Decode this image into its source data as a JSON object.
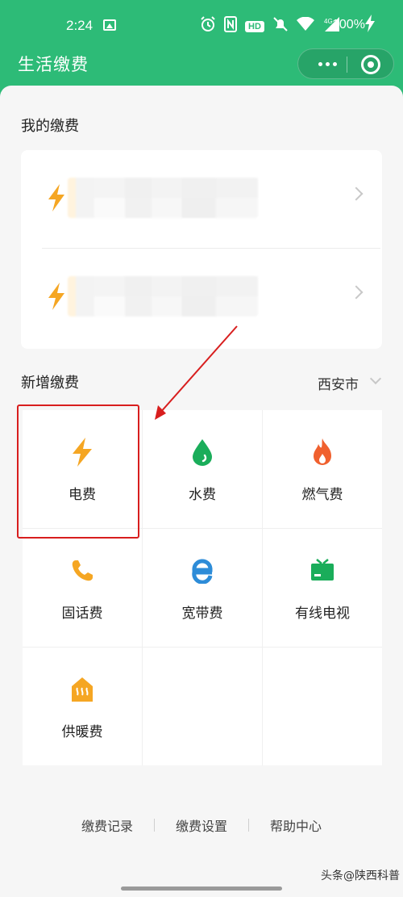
{
  "status_bar": {
    "time": "2:24",
    "icons": [
      "gallery-icon",
      "alarm-icon",
      "nfc-icon",
      "hd-icon",
      "mute-icon",
      "wifi-icon",
      "signal-icon"
    ],
    "hd_label": "HD",
    "network": "4G",
    "battery": "100%"
  },
  "navbar": {
    "title": "生活缴费",
    "more_icon": "more-dots-icon",
    "close_icon": "mini-program-close-icon"
  },
  "my_bills": {
    "title": "我的缴费",
    "items": [
      {
        "icon": "electricity-bolt-icon",
        "account": ""
      },
      {
        "icon": "electricity-bolt-icon",
        "account": ""
      }
    ]
  },
  "new_bills": {
    "title": "新增缴费",
    "city": "西安市",
    "services": [
      {
        "label": "电费",
        "icon": "bolt-icon",
        "color": "#f5a623"
      },
      {
        "label": "水费",
        "icon": "water-drop-icon",
        "color": "#1aad5a"
      },
      {
        "label": "燃气费",
        "icon": "flame-icon",
        "color": "#f0602e"
      },
      {
        "label": "固话费",
        "icon": "phone-icon",
        "color": "#f5a623"
      },
      {
        "label": "宽带费",
        "icon": "broadband-icon",
        "color": "#2d8cd8"
      },
      {
        "label": "有线电视",
        "icon": "tv-icon",
        "color": "#1aad5a"
      },
      {
        "label": "供暖费",
        "icon": "heating-icon",
        "color": "#f5a623"
      }
    ]
  },
  "footer": {
    "links": [
      "缴费记录",
      "缴费设置",
      "帮助中心"
    ]
  },
  "watermark": "头条@陕西科普",
  "colors": {
    "brand_green": "#2dbb77",
    "highlight_red": "#d81e1e"
  }
}
